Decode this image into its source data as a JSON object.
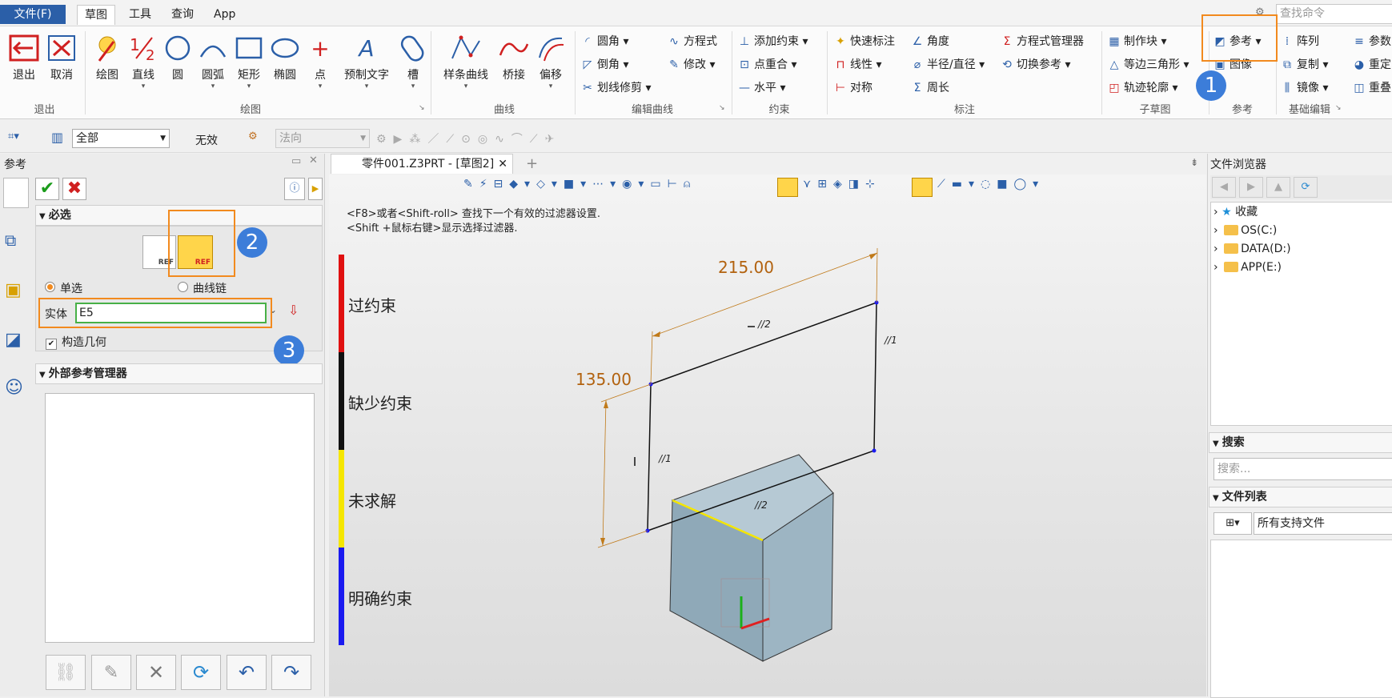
{
  "menu": {
    "file": "文件(F)",
    "tabs": [
      "草图",
      "工具",
      "查询",
      "App"
    ],
    "search_placeholder": "查找命令"
  },
  "ribbon": {
    "exit_group": {
      "exit": "退出",
      "cancel": "取消",
      "label": "退出"
    },
    "draw_group": {
      "items": [
        "绘图",
        "直线",
        "圆",
        "圆弧",
        "矩形",
        "椭圆",
        "点",
        "预制文字",
        "槽"
      ],
      "label": "绘图"
    },
    "curve_group": {
      "items": [
        "样条曲线",
        "桥接",
        "偏移"
      ],
      "label": "曲线"
    },
    "edit_group": {
      "items": [
        "圆角",
        "方程式",
        "倒角",
        "修改",
        "划线修剪"
      ],
      "label": "编辑曲线"
    },
    "constraint_group": {
      "items": [
        "添加约束",
        "点重合",
        "水平"
      ],
      "label": "约束"
    },
    "dimension_group": {
      "items": [
        "快速标注",
        "角度",
        "方程式管理器",
        "线性",
        "半径/直径",
        "切换参考",
        "对称",
        "周长"
      ],
      "label": "标注"
    },
    "subsketch_group": {
      "items": [
        "制作块",
        "等边三角形",
        "轨迹轮廓"
      ],
      "label": "子草图"
    },
    "reference_group": {
      "items": [
        "参考",
        "图像"
      ],
      "label": "参考"
    },
    "basic_edit_group": {
      "items": [
        "阵列",
        "复制",
        "镜像",
        "参数",
        "重定",
        "重叠"
      ],
      "label": "基础编辑"
    }
  },
  "toolbar2": {
    "filter": "全部",
    "invalid": "无效",
    "normal": "法向"
  },
  "left_panel": {
    "title": "参考",
    "required": "必选",
    "single": "单选",
    "curve_chain": "曲线链",
    "entity_label": "实体",
    "entity_value": "E5",
    "construct_geometry": "构造几何",
    "external_ref_manager": "外部参考管理器",
    "ref_icon_text": "REF"
  },
  "doc_tab": {
    "title": "零件001.Z3PRT - [草图2]"
  },
  "canvas": {
    "hint1": "<F8>或者<Shift-roll> 查找下一个有效的过滤器设置.",
    "hint2": "<Shift +鼠标右键>显示选择过滤器.",
    "legend": [
      "过约束",
      "缺少约束",
      "未求解",
      "明确约束"
    ],
    "legend_colors": [
      "#e01010",
      "#111111",
      "#f5e600",
      "#1a1af0"
    ],
    "dim_width": "215.00",
    "dim_height": "135.00",
    "marks": [
      "//2",
      "//1",
      "//1",
      "//2"
    ]
  },
  "right_panel": {
    "title": "文件浏览器",
    "tree": [
      "收藏",
      "OS(C:)",
      "DATA(D:)",
      "APP(E:)"
    ],
    "search_hdr": "搜索",
    "search_placeholder": "搜索...",
    "filelist_hdr": "文件列表",
    "file_filter": "所有支持文件"
  },
  "badges": [
    "1",
    "2",
    "3"
  ]
}
